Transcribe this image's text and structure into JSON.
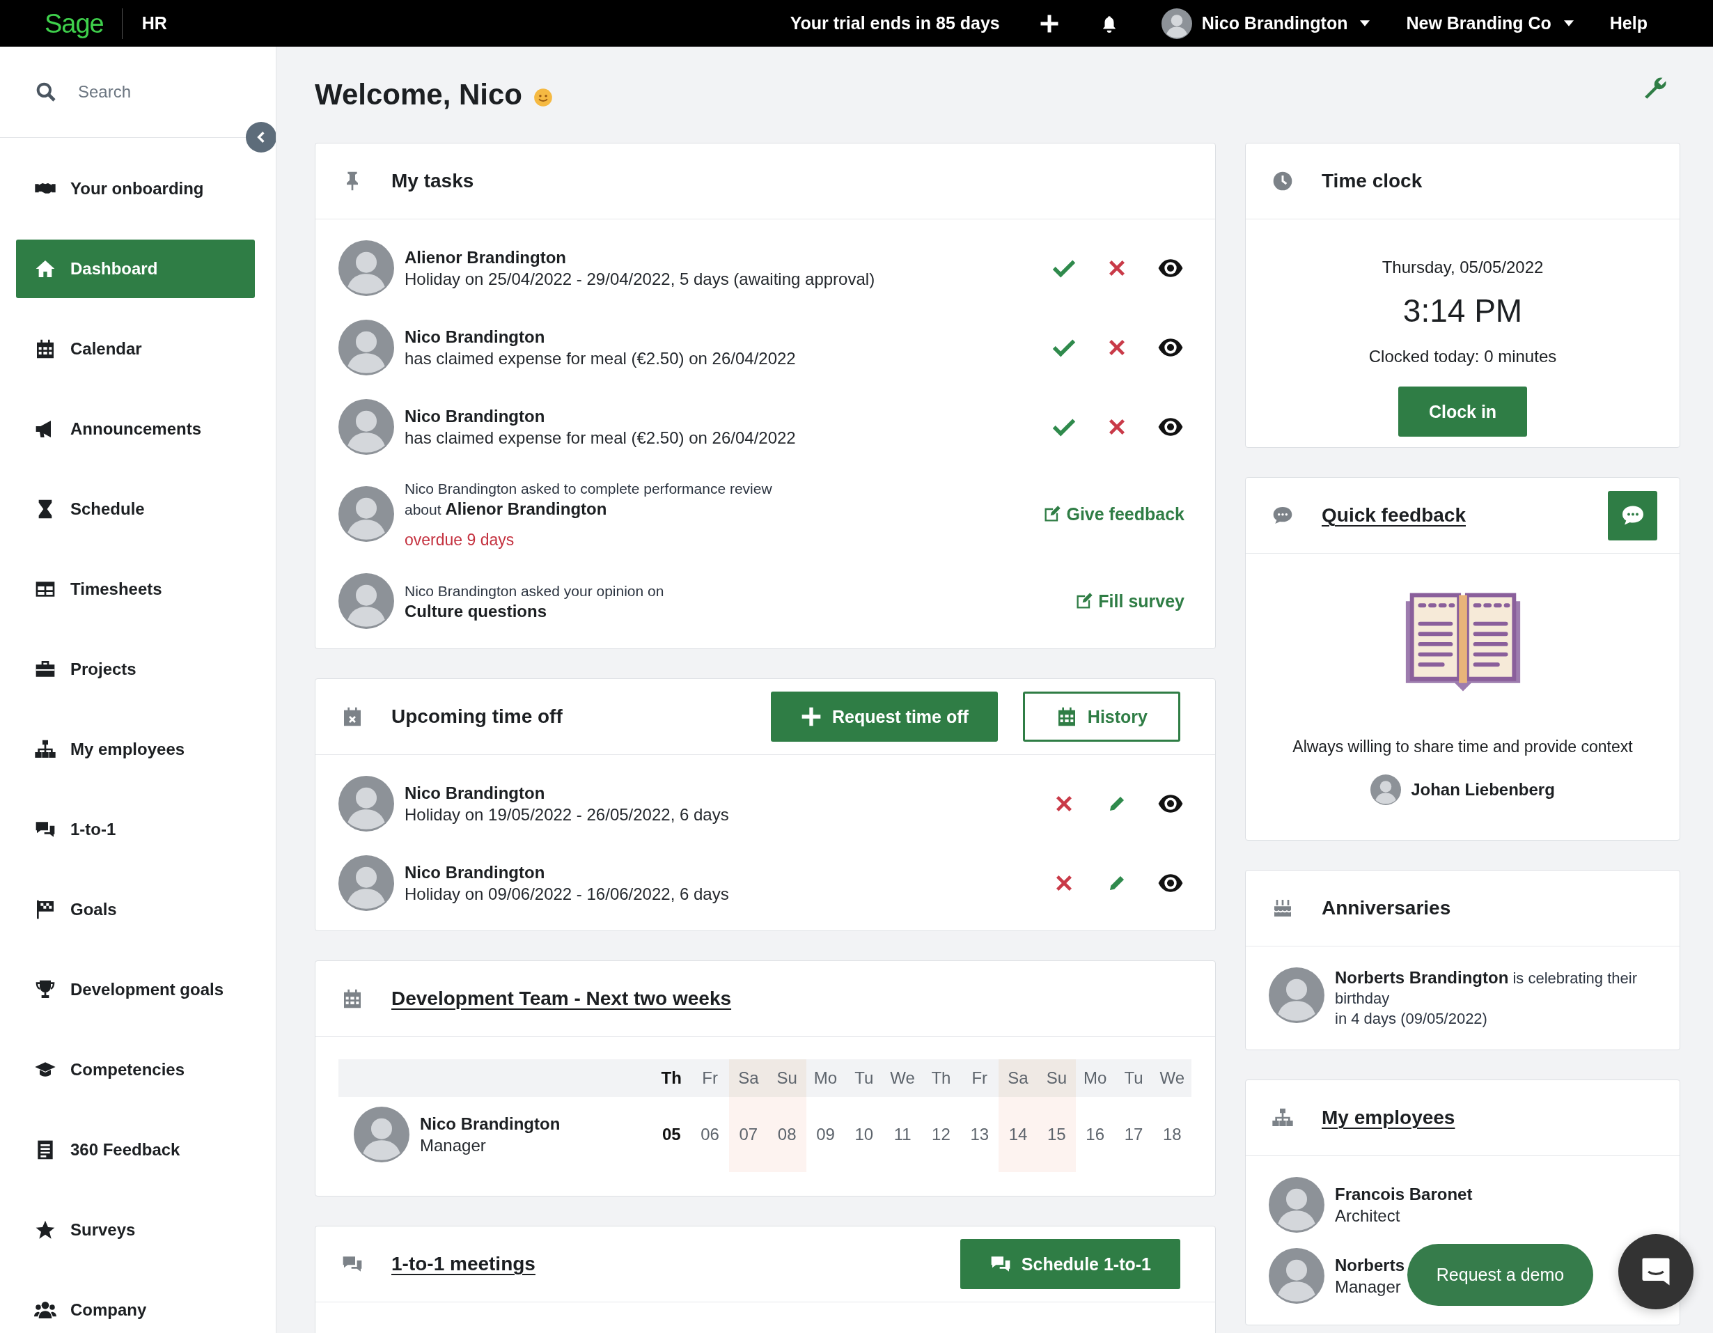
{
  "top_bar": {
    "logo": "Sage",
    "module": "HR",
    "trial": "Your trial ends in 85 days",
    "user": "Nico Brandington",
    "company": "New Branding Co",
    "help": "Help"
  },
  "sidebar": {
    "search": {
      "placeholder": "Search"
    },
    "items": [
      {
        "label": "Your onboarding",
        "selected": false
      },
      {
        "label": "Dashboard",
        "selected": true
      },
      {
        "label": "Calendar",
        "selected": false
      },
      {
        "label": "Announcements",
        "selected": false
      },
      {
        "label": "Schedule",
        "selected": false
      },
      {
        "label": "Timesheets",
        "selected": false
      },
      {
        "label": "Projects",
        "selected": false
      },
      {
        "label": "My employees",
        "selected": false
      },
      {
        "label": "1-to-1",
        "selected": false
      },
      {
        "label": "Goals",
        "selected": false
      },
      {
        "label": "Development goals",
        "selected": false
      },
      {
        "label": "Competencies",
        "selected": false
      },
      {
        "label": "360 Feedback",
        "selected": false
      },
      {
        "label": "Surveys",
        "selected": false
      },
      {
        "label": "Company",
        "selected": false
      }
    ]
  },
  "welcome": "Welcome, Nico",
  "my_tasks": {
    "title": "My tasks",
    "items": [
      {
        "kind": "approval",
        "name": "Alienor Brandington",
        "detail": "Holiday on 25/04/2022 - 29/04/2022, 5 days (awaiting approval)"
      },
      {
        "kind": "approval",
        "name": "Nico Brandington",
        "detail": "has claimed expense for meal (€2.50) on 26/04/2022"
      },
      {
        "kind": "approval",
        "name": "Nico Brandington",
        "detail": "has claimed expense for meal (€2.50) on 26/04/2022"
      },
      {
        "kind": "review",
        "request": "Nico Brandington asked to complete performance review",
        "about": "about **Alienor Brandington**",
        "overdue": "overdue 9 days",
        "action": "Give feedback"
      },
      {
        "kind": "survey",
        "request": "Nico Brandington asked your opinion on",
        "subject": "Culture questions",
        "action": "Fill survey"
      }
    ]
  },
  "upcoming_time_off": {
    "title": "Upcoming time off",
    "request_button": "Request time off",
    "history_button": "History",
    "items": [
      {
        "name": "Nico Brandington",
        "detail": "Holiday on 19/05/2022 - 26/05/2022, 6 days"
      },
      {
        "name": "Nico Brandington",
        "detail": "Holiday on 09/06/2022 - 16/06/2022, 6 days"
      }
    ]
  },
  "team_calendar": {
    "title": "Development Team - Next two weeks",
    "days": [
      {
        "day": "Th",
        "date": "05",
        "today": true,
        "weekend": false
      },
      {
        "day": "Fr",
        "date": "06",
        "today": false,
        "weekend": false
      },
      {
        "day": "Sa",
        "date": "07",
        "today": false,
        "weekend": true
      },
      {
        "day": "Su",
        "date": "08",
        "today": false,
        "weekend": true
      },
      {
        "day": "Mo",
        "date": "09",
        "today": false,
        "weekend": false
      },
      {
        "day": "Tu",
        "date": "10",
        "today": false,
        "weekend": false
      },
      {
        "day": "We",
        "date": "11",
        "today": false,
        "weekend": false
      },
      {
        "day": "Th",
        "date": "12",
        "today": false,
        "weekend": false
      },
      {
        "day": "Fr",
        "date": "13",
        "today": false,
        "weekend": false
      },
      {
        "day": "Sa",
        "date": "14",
        "today": false,
        "weekend": true
      },
      {
        "day": "Su",
        "date": "15",
        "today": false,
        "weekend": true
      },
      {
        "day": "Mo",
        "date": "16",
        "today": false,
        "weekend": false
      },
      {
        "day": "Tu",
        "date": "17",
        "today": false,
        "weekend": false
      },
      {
        "day": "We",
        "date": "18",
        "today": false,
        "weekend": false
      }
    ],
    "members": [
      {
        "name": "Nico Brandington",
        "role": "Manager"
      }
    ]
  },
  "one_to_one": {
    "title": "1-to-1 meetings",
    "button": "Schedule 1-to-1"
  },
  "time_clock": {
    "title": "Time clock",
    "date": "Thursday, 05/05/2022",
    "time": "3:14 PM",
    "clocked": "Clocked today: 0 minutes",
    "button": "Clock in"
  },
  "quick_feedback": {
    "title": "Quick feedback",
    "message": "Always willing to share time and provide context",
    "author": "Johan Liebenberg"
  },
  "anniversaries": {
    "title": "Anniversaries",
    "items": [
      {
        "text": "**Norberts Brandington** is celebrating their birthday",
        "when": "in 4 days (09/05/2022)"
      }
    ]
  },
  "my_employees": {
    "title": "My employees",
    "items": [
      {
        "name": "Francois Baronet",
        "role": "Architect"
      },
      {
        "name": "Norberts",
        "role": "Manager"
      }
    ]
  },
  "demo_button": "Request a demo"
}
